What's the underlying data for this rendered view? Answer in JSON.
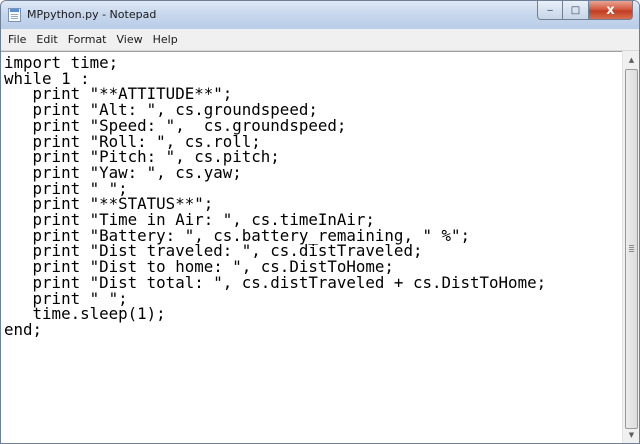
{
  "window": {
    "title": "MPpython.py - Notepad",
    "minimize_glyph": "‒",
    "maximize_glyph": "□",
    "close_glyph": "x"
  },
  "menu": [
    "File",
    "Edit",
    "Format",
    "View",
    "Help"
  ],
  "editor": {
    "lines": [
      "import time;",
      "",
      "while 1 :",
      "   print \"**ATTITUDE**\";",
      "   print \"Alt: \", cs.groundspeed;",
      "   print \"Speed: \",  cs.groundspeed;",
      "   print \"Roll: \", cs.roll;",
      "   print \"Pitch: \", cs.pitch;",
      "   print \"Yaw: \", cs.yaw;",
      "   print \" \";",
      "",
      "   print \"**STATUS**\";",
      "   print \"Time in Air: \", cs.timeInAir;",
      "   print \"Battery: \", cs.battery_remaining, \" %\";",
      "   print \"Dist traveled: \", cs.distTraveled;",
      "   print \"Dist to home: \", cs.DistToHome;",
      "   print \"Dist total: \", cs.distTraveled + cs.DistToHome;",
      "   print \" \";",
      "",
      "   time.sleep(1);",
      "end;"
    ]
  },
  "scrollbar": {
    "up_glyph": "▲",
    "down_glyph": "▼"
  }
}
